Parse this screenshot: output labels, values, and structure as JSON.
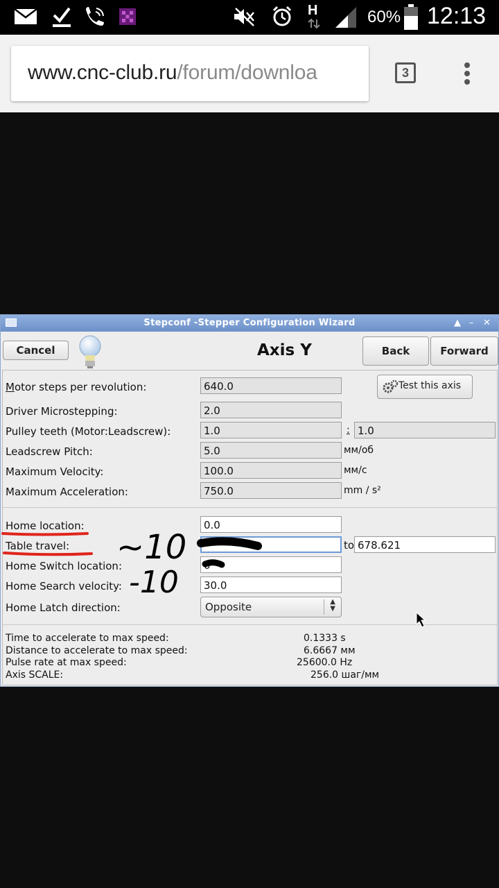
{
  "status_bar": {
    "battery": "60%",
    "time": "12:13",
    "network_letter": "H",
    "icons": [
      "mail-icon",
      "check-icon",
      "phone-icon",
      "app-icon",
      "mute-icon",
      "alarm-icon",
      "signal-icon",
      "battery-icon"
    ]
  },
  "browser": {
    "url_host": "www.cnc-club.ru",
    "url_path": "/forum/downloa",
    "tab_count": "3"
  },
  "window": {
    "title": "Stepconf -Stepper Configuration Wizard",
    "heading": "Axis Y",
    "cancel_label": "Cancel",
    "back_label": "Back",
    "forward_label": "Forward",
    "test_axis_label": "Test this axis"
  },
  "motor": {
    "steps_label": "Motor steps per revolution:",
    "steps_value": "640.0",
    "microstep_label": "Driver Microstepping:",
    "microstep_value": "2.0",
    "pulley_label": "Pulley teeth (Motor:Leadscrew):",
    "pulley_motor": "1.0",
    "pulley_sep": ":",
    "pulley_leadscrew": "1.0",
    "pitch_label": "Leadscrew Pitch:",
    "pitch_value": "5.0",
    "pitch_unit": "мм/об",
    "vel_label": "Maximum Velocity:",
    "vel_value": "100.0",
    "vel_unit": "мм/с",
    "acc_label": "Maximum Acceleration:",
    "acc_value": "750.0",
    "acc_unit": "mm / s²"
  },
  "home": {
    "location_label": "Home location:",
    "location_value": "0.0",
    "travel_label": "Table travel:",
    "travel_from": "",
    "travel_to_label": "to",
    "travel_to": "678.621",
    "switch_label": "Home Switch location:",
    "switch_value": "0",
    "search_label": "Home Search velocity:",
    "search_value": "30.0",
    "latch_label": "Home Latch direction:",
    "latch_value": "Opposite"
  },
  "stats": {
    "accel_time_label": "Time to accelerate to max speed:",
    "accel_time_value": "0.1333 s",
    "accel_dist_label": "Distance to accelerate to max speed:",
    "accel_dist_value": "6.6667 мм",
    "pulse_label": "Pulse rate at max speed:",
    "pulse_value": "25600.0 Hz",
    "scale_label": "Axis SCALE:",
    "scale_value": "256.0 шаг/мм"
  },
  "annotations": {
    "travel_note": "~10",
    "search_note": "-10",
    "colors": {
      "underline": "#e0241b",
      "ink": "#000000"
    }
  }
}
